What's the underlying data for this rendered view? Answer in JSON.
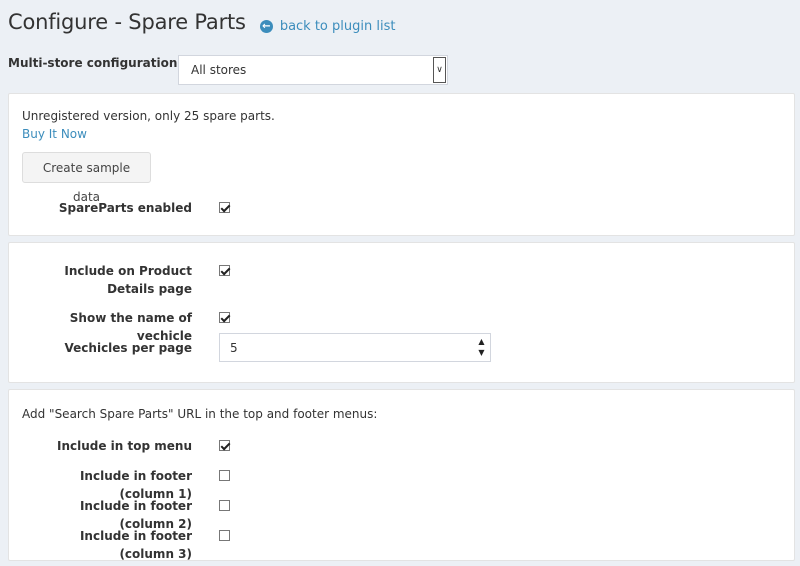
{
  "header": {
    "title": "Configure - Spare Parts",
    "back_label": "back to plugin list"
  },
  "multistore": {
    "label": "Multi-store configuration for",
    "selected": "All stores"
  },
  "general": {
    "notice": "Unregistered version, only 25 spare parts.",
    "buy_label": "Buy It Now",
    "sample_button": "Create sample data",
    "enabled_label": "SpareParts enabled",
    "enabled": true
  },
  "display": {
    "include_product_label": "Include on Product Details page",
    "include_product": true,
    "show_name_label": "Show the name of vechicle",
    "show_name": true,
    "per_page_label": "Vechicles per page",
    "per_page_value": "5"
  },
  "menus": {
    "note": "Add \"Search Spare Parts\" URL in the top and footer menus:",
    "items": [
      {
        "label": "Include in top menu",
        "checked": true
      },
      {
        "label": "Include in footer (column 1)",
        "checked": false
      },
      {
        "label": "Include in footer (column 2)",
        "checked": false
      },
      {
        "label": "Include in footer (column 3)",
        "checked": false
      }
    ]
  }
}
